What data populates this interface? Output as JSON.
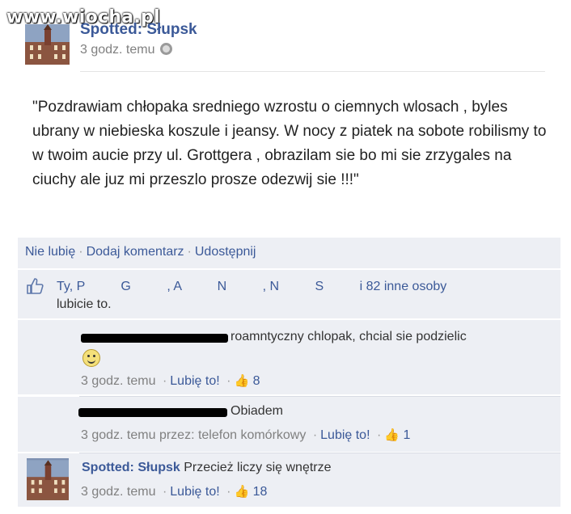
{
  "watermark": "www.wiocha.pl",
  "post": {
    "page_name": "Spotted: Słupsk",
    "timestamp": "3 godz. temu",
    "body": "\"Pozdrawiam chłopaka sredniego wzrostu o ciemnych wlosach , byles ubrany w niebieska koszule i jeansy. W nocy z piatek na sobote robilismy to w twoim aucie przy ul. Grottgera , obrazilam sie bo mi sie zrzygales na ciuchy ale juz mi przeszlo prosze odezwij sie !!!\""
  },
  "actions": {
    "unlike": "Nie lubię",
    "comment": "Dodaj komentarz",
    "share": "Udostępnij",
    "separator": "·"
  },
  "likes": {
    "names": "Ty, P          G          , A          N          , N          S",
    "others": "i 82 inne osoby",
    "suffix": "lubicie to."
  },
  "comments": [
    {
      "text": "roamntyczny chlopak, chcial sie podzielic",
      "meta_time": "3 godz. temu",
      "like_label": "Lubię to!",
      "like_count": "8"
    },
    {
      "text": "Obiadem",
      "meta_time": "3 godz. temu przez: telefon komórkowy",
      "like_label": "Lubię to!",
      "like_count": "1"
    },
    {
      "author": "Spotted: Słupsk",
      "text": "Przecież liczy się wnętrze",
      "meta_time": "3 godz. temu",
      "like_label": "Lubię to!",
      "like_count": "18"
    }
  ],
  "icons": {
    "privacy": "globe-icon",
    "like": "thumbs-up-icon",
    "emoticon": "smiley-icon"
  },
  "colors": {
    "link": "#3b5998",
    "panel": "#edeff4",
    "meta": "#808080"
  }
}
